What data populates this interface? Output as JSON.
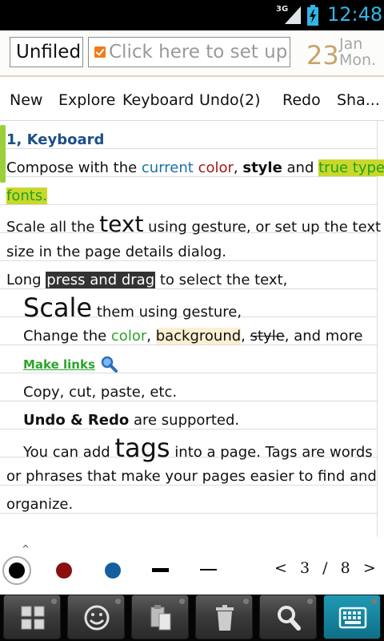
{
  "status": {
    "network": "3G",
    "time": "12:48"
  },
  "header": {
    "folder": "Unfiled",
    "tags_placeholder": "Click here to set up...",
    "date_day": "23",
    "date_month": "Jan",
    "date_weekday": "Mon."
  },
  "toolbar": {
    "new": "New",
    "explore": "Explore",
    "keyboard": "Keyboard",
    "undo": "Undo(2)",
    "redo": "Redo",
    "share": "Sha..."
  },
  "note": {
    "heading": "1, Keyboard",
    "l1_a": "Compose with the ",
    "l1_current": "current",
    "l1_sp1": " ",
    "l1_color": "color",
    "l1_comma": ", ",
    "l1_style": "style",
    "l1_and": " and ",
    "l1_truetype": "true type",
    "l2_fonts": "fonts.",
    "l3_a": "Scale all the ",
    "l3_text": "text",
    "l3_b": " using gesture, or set up the text",
    "l4": "size in the page details dialog.",
    "l5_a": "Long ",
    "l5_press": "press and drag",
    "l5_b": " to select the text,",
    "l6_scale": "Scale",
    "l6_b": " them using gesture,",
    "l7_a": "Change the ",
    "l7_color": "color",
    "l7_comma": ", ",
    "l7_background": "background",
    "l7_comma2": ", ",
    "l7_style": "style",
    "l7_b": ", and more",
    "l8_link": "Make links",
    "l9": "Copy, cut, paste, etc.",
    "l10_bold": "Undo & Redo",
    "l10_b": " are supported.",
    "l11_a": "You can add ",
    "l11_tags": "tags",
    "l11_b": " into a page. Tags are words",
    "l12": "or phrases that make your pages easier to find and",
    "l13": "organize."
  },
  "palette": {
    "caret": "^",
    "colors": [
      "#000000",
      "#8b0f0f",
      "#145fa0"
    ],
    "pager_prev": "<",
    "pager_current": "3",
    "pager_sep": "/",
    "pager_total": "8",
    "pager_next": ">"
  },
  "bottom_icons": [
    "grid-icon",
    "smiley-icon",
    "paste-icon",
    "trash-icon",
    "search-icon",
    "keyboard-icon"
  ]
}
